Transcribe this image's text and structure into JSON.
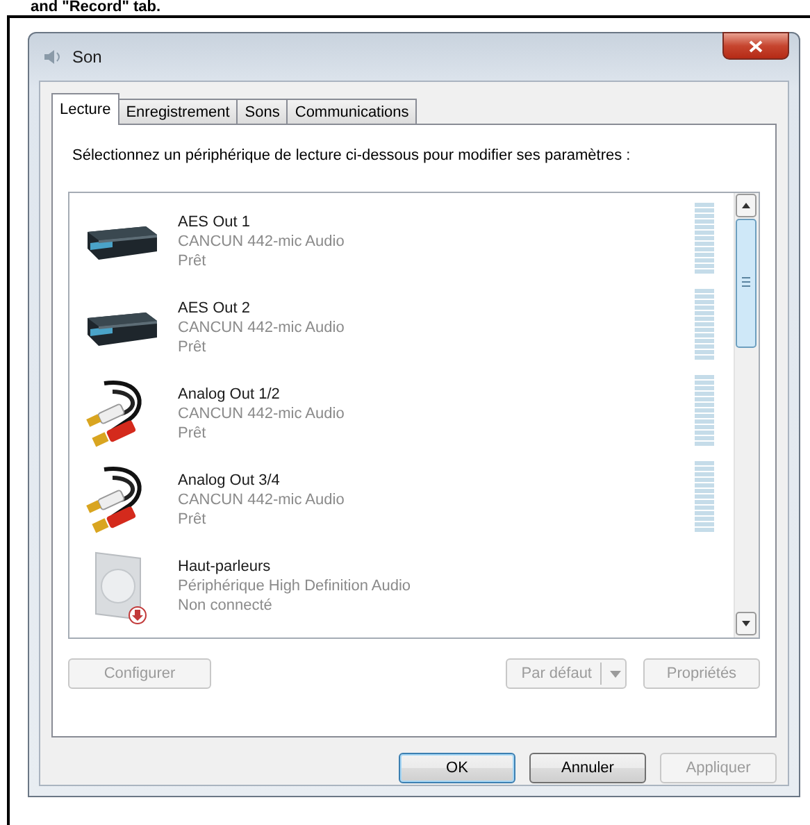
{
  "caption": "and \"Record\" tab.",
  "window": {
    "title": "Son"
  },
  "tabs": [
    {
      "label": "Lecture",
      "selected": true
    },
    {
      "label": "Enregistrement",
      "selected": false
    },
    {
      "label": "Sons",
      "selected": false
    },
    {
      "label": "Communications",
      "selected": false
    }
  ],
  "instruction": "Sélectionnez un périphérique de lecture ci-dessous pour modifier ses paramètres :",
  "devices": [
    {
      "kind": "digital",
      "name": "AES Out 1",
      "driver": "CANCUN 442-mic Audio",
      "status": "Prêt",
      "connected": true
    },
    {
      "kind": "digital",
      "name": "AES Out 2",
      "driver": "CANCUN 442-mic Audio",
      "status": "Prêt",
      "connected": true
    },
    {
      "kind": "analog",
      "name": "Analog Out 1/2",
      "driver": "CANCUN 442-mic Audio",
      "status": "Prêt",
      "connected": true
    },
    {
      "kind": "analog",
      "name": "Analog Out 3/4",
      "driver": "CANCUN 442-mic Audio",
      "status": "Prêt",
      "connected": true
    },
    {
      "kind": "speaker",
      "name": "Haut-parleurs",
      "driver": "Périphérique High Definition Audio",
      "status": "Non connecté",
      "connected": false
    }
  ],
  "panel_buttons": [
    {
      "kind": "plain",
      "label": "Configurer",
      "disabled": true
    },
    {
      "kind": "split",
      "label": "Par défaut",
      "disabled": true
    },
    {
      "kind": "plain",
      "label": "Propriétés",
      "disabled": true
    }
  ],
  "dialog_buttons": [
    {
      "label": "OK",
      "disabled": false,
      "default": true
    },
    {
      "label": "Annuler",
      "disabled": false,
      "default": false
    },
    {
      "label": "Appliquer",
      "disabled": true,
      "default": false
    }
  ]
}
